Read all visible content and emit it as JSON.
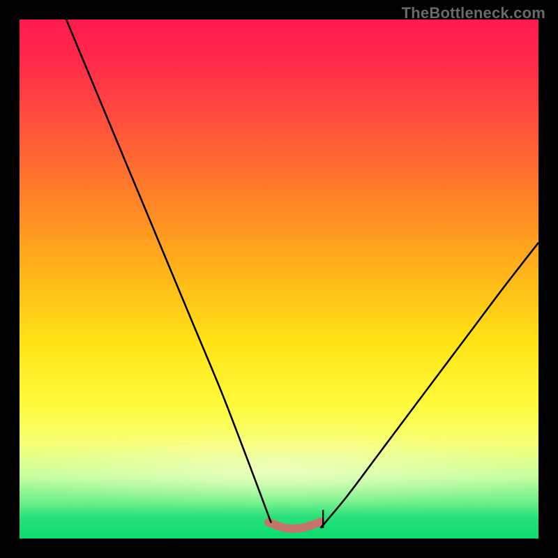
{
  "watermark": "TheBottleneck.com",
  "colors": {
    "background": "#000000",
    "curve": "#000000",
    "trough_highlight": "#d46a6a",
    "gradient_stops": [
      "#ff1a4d",
      "#ff2a4a",
      "#ff4a3e",
      "#ff7a2a",
      "#ffb21a",
      "#ffe315",
      "#fffb3a",
      "#f6ff78",
      "#c6ffa0",
      "#6df08a",
      "#28e07a",
      "#0bdc6e"
    ]
  },
  "chart_data": {
    "type": "line",
    "title": "",
    "xlabel": "",
    "ylabel": "",
    "xlim": [
      0,
      100
    ],
    "ylim": [
      0,
      100
    ],
    "grid": false,
    "curve_left": {
      "x": [
        9,
        14,
        19,
        24,
        29,
        34,
        39,
        44,
        48.5
      ],
      "y": [
        100,
        88,
        76,
        64,
        52,
        40,
        28,
        15,
        3
      ]
    },
    "curve_right": {
      "x": [
        58,
        63,
        69,
        75,
        81,
        87,
        93,
        100
      ],
      "y": [
        2,
        8,
        16,
        24,
        32,
        40,
        48,
        57
      ]
    },
    "trough_segment": {
      "x_start": 48,
      "x_end": 58,
      "y": 2.5
    },
    "interior_tick": {
      "x": 58.5,
      "y0": 2.0,
      "y1": 5.5
    }
  }
}
